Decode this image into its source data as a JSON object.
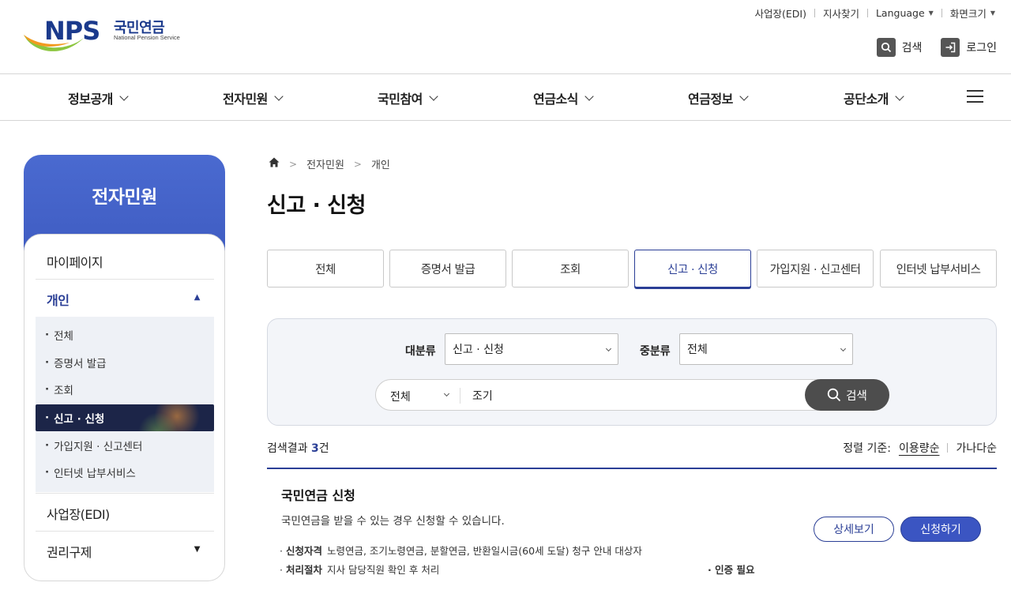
{
  "brand": {
    "logo_text": "NPS",
    "name_kr": "국민연금",
    "name_en": "National Pension Service"
  },
  "utility": [
    {
      "label": "사업장(EDI)"
    },
    {
      "label": "지사찾기"
    },
    {
      "label": "Language"
    },
    {
      "label": "화면크기"
    }
  ],
  "quick": {
    "search": "검색",
    "login": "로그인"
  },
  "gnb": [
    "정보공개",
    "전자민원",
    "국민참여",
    "연금소식",
    "연금정보",
    "공단소개"
  ],
  "lnb": {
    "title": "전자민원",
    "menus": [
      "마이페이지",
      "개인",
      "사업장(EDI)",
      "권리구제"
    ],
    "sub": [
      "전체",
      "증명서 발급",
      "조회",
      "신고 · 신청",
      "가입지원 · 신고센터",
      "인터넷 납부서비스"
    ]
  },
  "breadcrumb": [
    "전자민원",
    "개인"
  ],
  "page_title": "신고 · 신청",
  "tabs": [
    "전체",
    "증명서 발급",
    "조회",
    "신고 · 신청",
    "가입지원 · 신고센터",
    "인터넷 납부서비스"
  ],
  "search": {
    "major_label": "대분류",
    "major_value": "신고 · 신청",
    "minor_label": "중분류",
    "minor_value": "전체",
    "scope": "전체",
    "query": "조기",
    "button": "검색"
  },
  "results": {
    "prefix": "검색결과",
    "count": "3",
    "suffix": "건",
    "sort_label": "정렬 기준:",
    "sort_options": [
      "이용량순",
      "가나다순"
    ]
  },
  "item": {
    "title": "국민연금 신청",
    "desc": "국민연금을 받을 수 있는 경우 신청할 수 있습니다.",
    "eligibility_label": "신청자격",
    "eligibility": "노령연금, 조기노령연금, 분할연금, 반환일시금(60세 도달) 청구 안내 대상자",
    "process_label": "처리절차",
    "process": "지사 담당직원 확인 후 처리",
    "auth": "인증 필요",
    "detail_button": "상세보기",
    "apply_button": "신청하기"
  },
  "colors": {
    "primary": "#2b3f96",
    "lnb_head": "#4a6ad0",
    "active_sub": "#1c2548",
    "search_btn": "#4d4d4d"
  }
}
